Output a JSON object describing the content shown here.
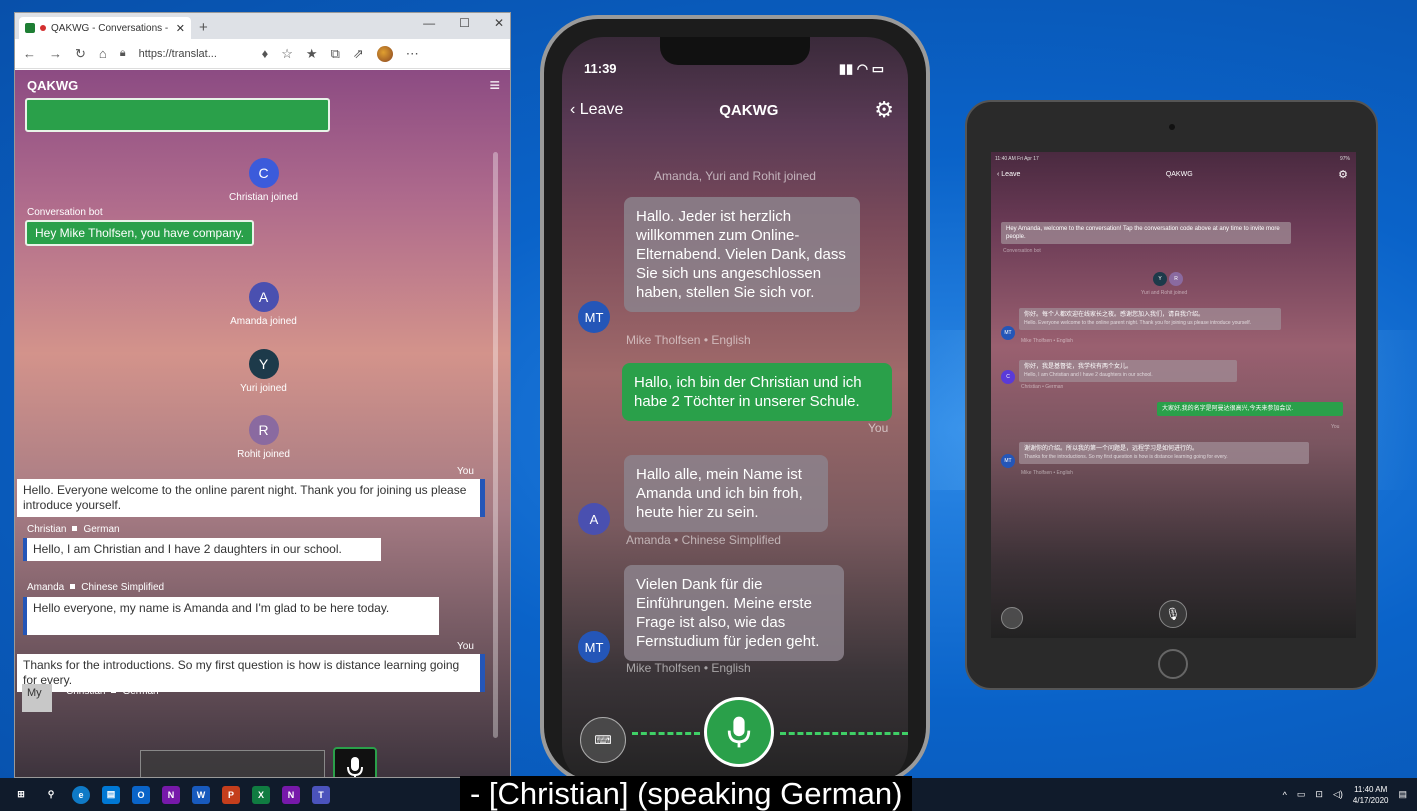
{
  "browser": {
    "tab_title": "QAKWG - Conversations - T",
    "url": "https://translat...",
    "app_title": "QAKWG",
    "joined": [
      {
        "initial": "C",
        "text": "Christian joined",
        "color": "#3b5bdb"
      },
      {
        "initial": "A",
        "text": "Amanda joined",
        "color": "#4a50b0"
      },
      {
        "initial": "Y",
        "text": "Yuri joined",
        "color": "#1d3a4a"
      },
      {
        "initial": "R",
        "text": "Rohit joined",
        "color": "#8a6aa0"
      }
    ],
    "bot_sender": "Conversation bot",
    "bot_message": "Hey Mike Tholfsen, you have company.",
    "you_label": "You",
    "messages": {
      "m1": "Hello. Everyone welcome to the online parent night. Thank you for joining us please introduce yourself.",
      "m2_sender": "Christian",
      "m2_lang": "German",
      "m2": "Hello, I am Christian and I have 2 daughters in our school.",
      "m3_sender": "Amanda",
      "m3_lang": "Chinese Simplified",
      "m3": "Hello everyone, my name is Amanda and I'm glad to be here today.",
      "m4": "Thanks for the introductions. So my first question is how is distance learning going for every."
    },
    "draft": {
      "avatar": "My",
      "sender": "Christian",
      "lang": "German"
    }
  },
  "phone": {
    "time": "11:39",
    "leave": "Leave",
    "title": "QAKWG",
    "joined": "Amanda, Yuri and Rohit joined",
    "msgs": [
      {
        "text": "Hallo. Jeder ist herzlich willkommen zum Online-Elternabend. Vielen Dank, dass Sie sich uns angeschlossen haben, stellen Sie sich vor.",
        "avatar": "MT",
        "meta": "Mike Tholfsen • English"
      },
      {
        "text": "Hallo, ich bin der Christian und ich habe 2 Töchter in unserer Schule.",
        "you": "You"
      },
      {
        "text": "Hallo alle, mein Name ist Amanda und ich bin froh, heute hier zu sein.",
        "avatar": "A",
        "meta": "Amanda • Chinese Simplified"
      },
      {
        "text": "Vielen Dank für die Einführungen. Meine erste Frage ist also, wie das Fernstudium für jeden geht.",
        "avatar": "MT",
        "meta": "Mike Tholfsen • English"
      }
    ]
  },
  "tablet": {
    "status_left": "11:40 AM  Fri Apr 17",
    "status_right": "97%",
    "leave": "Leave",
    "title": "QAKWG",
    "welcome": "Hey Amanda, welcome to the conversation! Tap the conversation code above at any time to invite more people.",
    "welcome_meta": "Conversation bot",
    "joined_meta": "Yuri and Rohit joined",
    "m1": "你好。每个人都欢迎在线家长之夜。感谢您加入我们，请自我介绍。",
    "m1_sub": "Hello. Everyone welcome to the online parent night. Thank you for joining us please introduce yourself.",
    "m1_meta": "Mike Tholfsen • English",
    "m2": "你好，我是基督徒，我学校有两个女儿。",
    "m2_sub": "Hello, I am Christian and I have 2 daughters in our school.",
    "m2_meta": "Christian • German",
    "m3": "大家好,我的名字是阿曼达很高兴,今天来参加会议.",
    "m3_you": "You",
    "m4": "谢谢你的介绍。所以我的第一个问题是，远程学习是如何进行的。",
    "m4_sub": "Thanks for the introductions. So my first question is how is distance learning going for every.",
    "m4_meta": "Mike Tholfsen • English"
  },
  "caption": "- [Christian] (speaking German)",
  "taskbar": {
    "time": "11:40 AM",
    "date": "4/17/2020"
  },
  "colors": {
    "accent_green": "#2aa04a",
    "accent_blue": "#2456b8",
    "desktop": "#0a63c9"
  }
}
